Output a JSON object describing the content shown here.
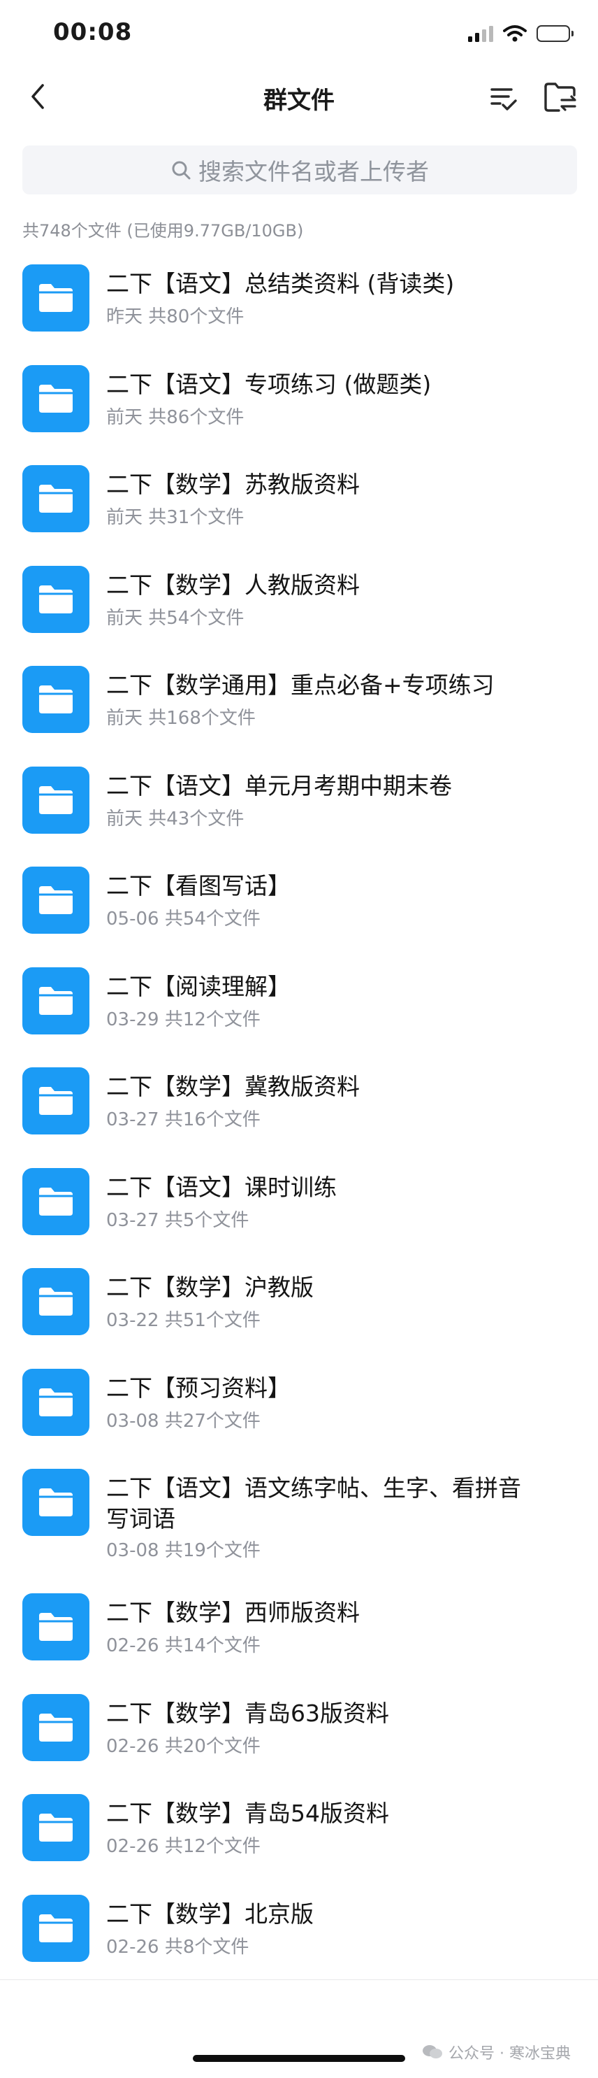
{
  "status_bar": {
    "time": "00:08"
  },
  "nav": {
    "title": "群文件"
  },
  "search": {
    "placeholder": "搜索文件名或者上传者"
  },
  "summary": "共748个文件 (已使用9.77GB/10GB)",
  "files": [
    {
      "name": "二下【语文】总结类资料 (背读类)",
      "meta": "昨天 共80个文件"
    },
    {
      "name": "二下【语文】专项练习 (做题类)",
      "meta": "前天 共86个文件"
    },
    {
      "name": "二下【数学】苏教版资料",
      "meta": "前天 共31个文件"
    },
    {
      "name": "二下【数学】人教版资料",
      "meta": "前天 共54个文件"
    },
    {
      "name": "二下【数学通用】重点必备+专项练习",
      "meta": "前天 共168个文件"
    },
    {
      "name": "二下【语文】单元月考期中期末卷",
      "meta": "前天 共43个文件"
    },
    {
      "name": "二下【看图写话】",
      "meta": "05-06 共54个文件"
    },
    {
      "name": "二下【阅读理解】",
      "meta": "03-29 共12个文件"
    },
    {
      "name": "二下【数学】冀教版资料",
      "meta": "03-27 共16个文件"
    },
    {
      "name": "二下【语文】课时训练",
      "meta": "03-27 共5个文件"
    },
    {
      "name": "二下【数学】沪教版",
      "meta": "03-22 共51个文件"
    },
    {
      "name": "二下【预习资料】",
      "meta": "03-08 共27个文件"
    },
    {
      "name": "二下【语文】语文练字帖、生字、看拼音写词语",
      "meta": "03-08 共19个文件"
    },
    {
      "name": "二下【数学】西师版资料",
      "meta": "02-26 共14个文件"
    },
    {
      "name": "二下【数学】青岛63版资料",
      "meta": "02-26 共20个文件"
    },
    {
      "name": "二下【数学】青岛54版资料",
      "meta": "02-26 共12个文件"
    },
    {
      "name": "二下【数学】北京版",
      "meta": "02-26 共8个文件"
    }
  ],
  "watermark": "公众号 · 寒冰宝典",
  "colors": {
    "accent": "#1b9bf5",
    "secondary_text": "#8f929a",
    "search_bg": "#f4f5f8"
  },
  "icons": [
    "signal-icon",
    "wifi-icon",
    "battery-icon",
    "back-arrow-icon",
    "sort-icon",
    "folder-switch-icon",
    "search-icon",
    "folder-icon"
  ]
}
